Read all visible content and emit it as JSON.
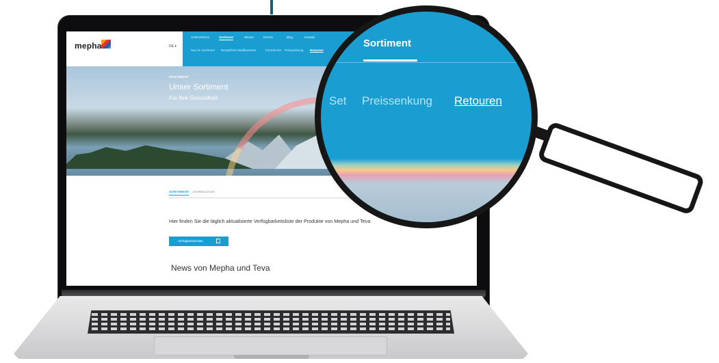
{
  "site": {
    "logo_text": "mepha",
    "language": "DE ▾"
  },
  "nav": {
    "top": [
      "Unternehmen",
      "Sortiment",
      "Wissen",
      "Events",
      "Blog",
      "Kontakt"
    ],
    "active_top": "Sortiment",
    "sub": [
      "Neu im Sortiment",
      "Rezeptfreie Medikamente",
      "Friends Set",
      "Preissenkung",
      "Retouren"
    ],
    "active_sub": "Retouren"
  },
  "hero": {
    "kicker": "SORTIMENT",
    "title": "Unser Sortiment",
    "subtitle": "Für Ihre Gesundheit"
  },
  "tabs": [
    "SORTIMENT",
    "DOWNLOADS"
  ],
  "intro_text": "Hier finden Sie die täglich aktualisierte Verfügbarkeitsliste der Produkte von Mepha und Teva",
  "cta_label": "Verfügbarkeitsliste",
  "news_heading": "News von Mepha und Teva",
  "magnifier": {
    "active": "Sortiment",
    "sub_fragment": "Set",
    "sub_mid": "Preissenkung",
    "sub_active": "Retouren"
  },
  "colors": {
    "brand_blue": "#1a9ed2",
    "text_dark": "#333333"
  },
  "icons": [
    "document-icon",
    "flag-logo-icon"
  ]
}
